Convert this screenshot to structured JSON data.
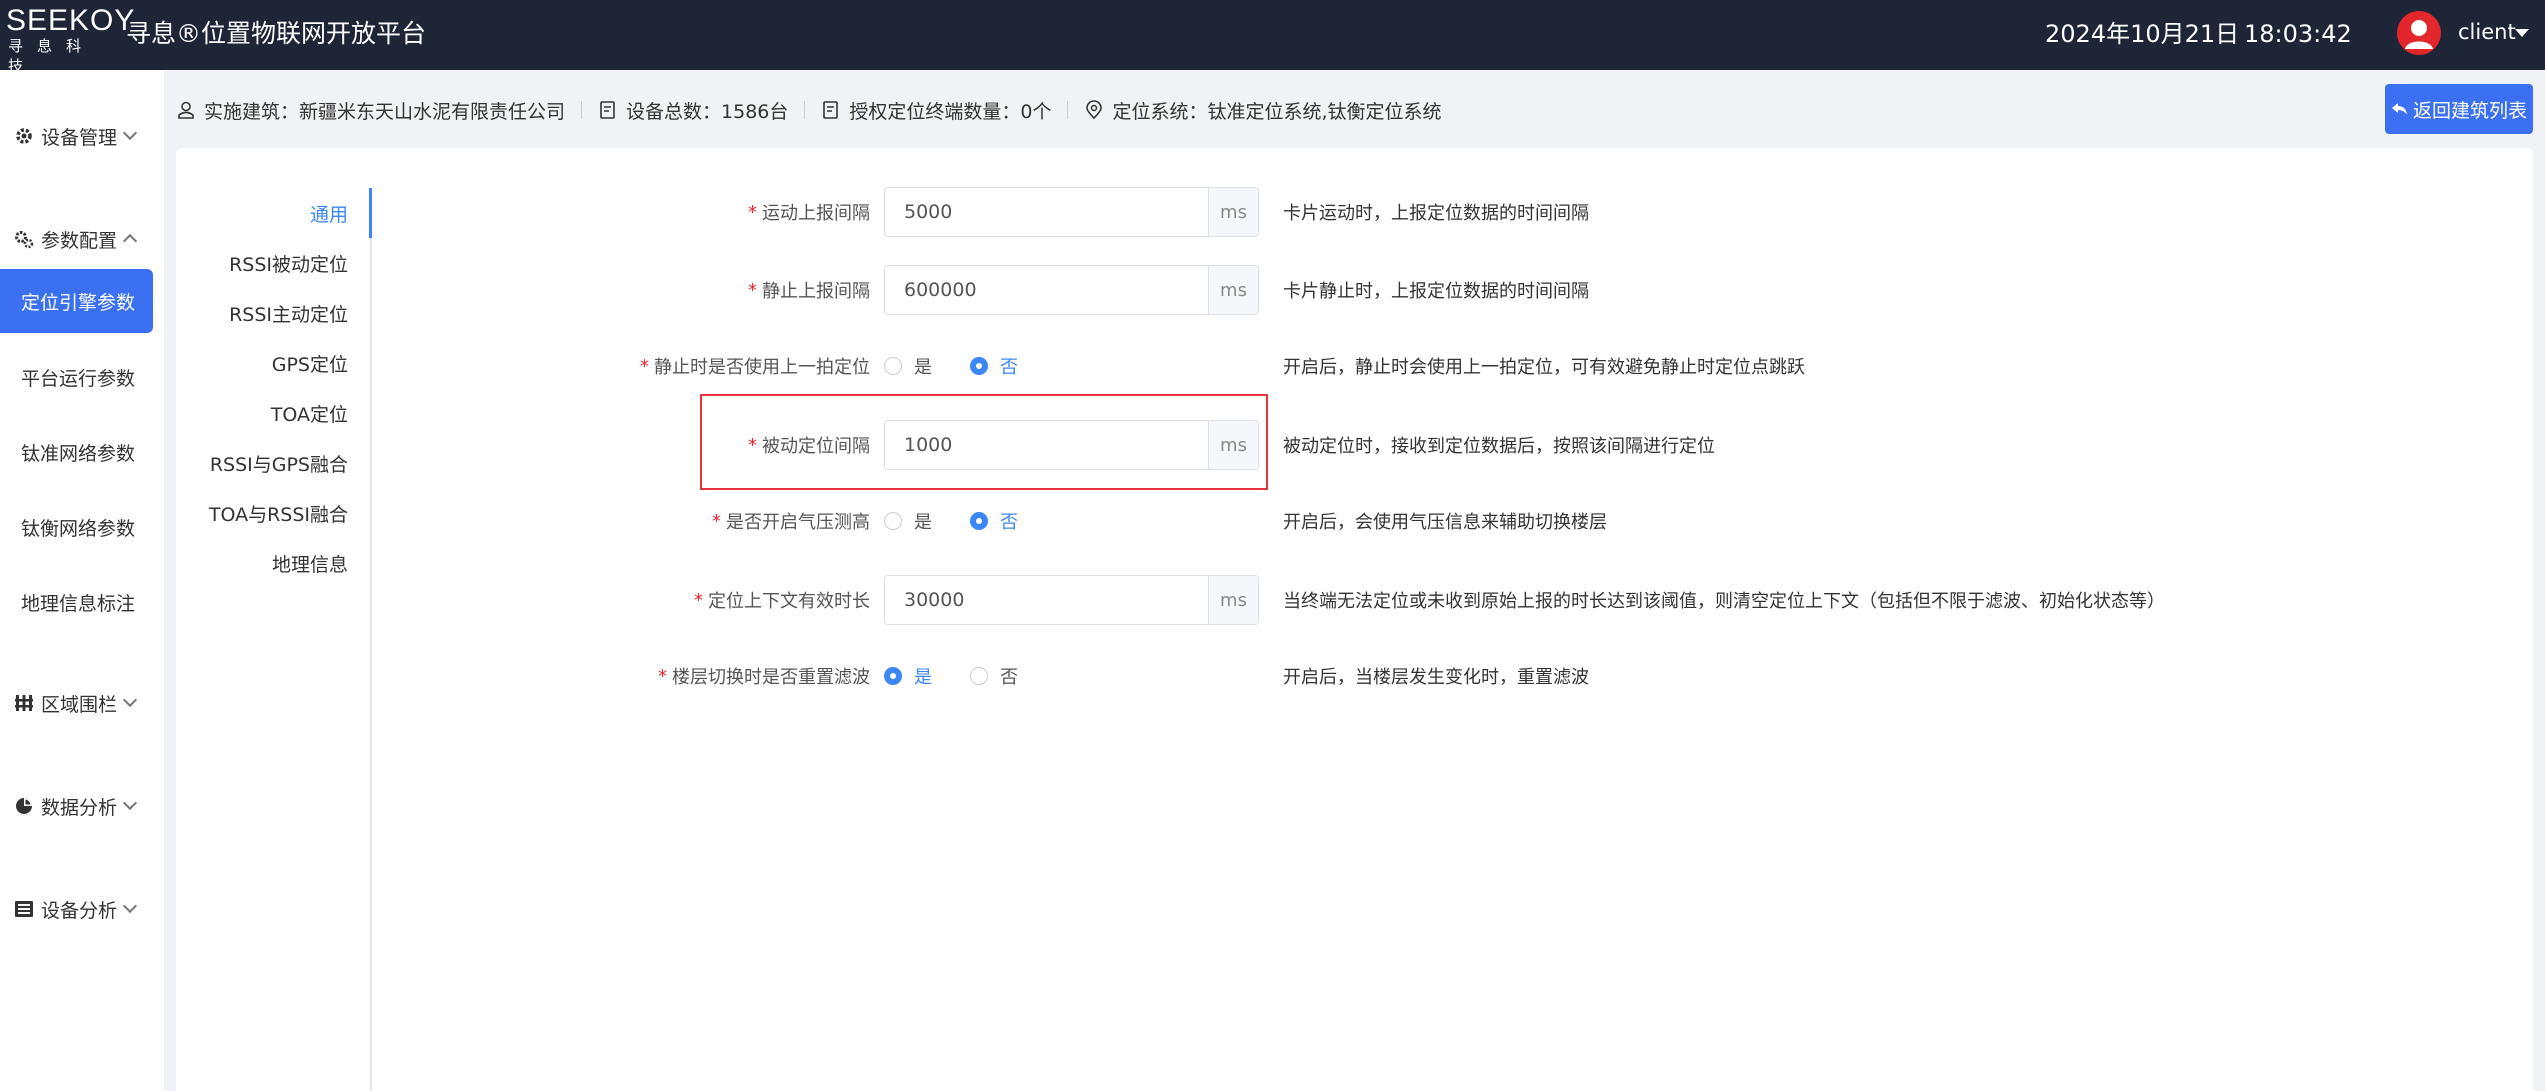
{
  "header": {
    "logo_brand": "SEEKOY",
    "logo_sub": "寻息科技",
    "title": "寻息®位置物联网开放平台",
    "date": "2024年10月21日",
    "time": "18:03:42",
    "username": "client"
  },
  "sidebar": {
    "groups": {
      "device_mgmt": "设备管理",
      "param_config": "参数配置",
      "area_fence": "区域围栏",
      "data_analysis": "数据分析",
      "device_analysis": "设备分析"
    },
    "items": {
      "engine_params": "定位引擎参数",
      "platform_params": "平台运行参数",
      "taizhun_params": "钛准网络参数",
      "taiheng_params": "钛衡网络参数",
      "geo_label": "地理信息标注"
    }
  },
  "infobar": {
    "building": "实施建筑：新疆米东天山水泥有限责任公司",
    "device_total": "设备总数：1586台",
    "licensed": "授权定位终端数量：0个",
    "system": "定位系统：钛准定位系统,钛衡定位系统",
    "back_button": "返回建筑列表"
  },
  "subnav": {
    "items": [
      "通用",
      "RSSI被动定位",
      "RSSI主动定位",
      "GPS定位",
      "TOA定位",
      "RSSI与GPS融合",
      "TOA与RSSI融合",
      "地理信息"
    ],
    "active": "通用"
  },
  "form": {
    "required_mark": "*",
    "unit": "ms",
    "yes": "是",
    "no": "否",
    "motion_interval": {
      "label": "运动上报间隔",
      "value": "5000",
      "desc": "卡片运动时，上报定位数据的时间间隔"
    },
    "static_interval": {
      "label": "静止上报间隔",
      "value": "600000",
      "desc": "卡片静止时，上报定位数据的时间间隔"
    },
    "static_use_last": {
      "label": "静止时是否使用上一拍定位",
      "selected": "否",
      "desc": "开启后，静止时会使用上一拍定位，可有效避免静止时定位点跳跃"
    },
    "passive_interval": {
      "label": "被动定位间隔",
      "value": "1000",
      "desc": "被动定位时，接收到定位数据后，按照该间隔进行定位"
    },
    "barometer": {
      "label": "是否开启气压测高",
      "selected": "否",
      "desc": "开启后，会使用气压信息来辅助切换楼层"
    },
    "context_valid": {
      "label": "定位上下文有效时长",
      "value": "30000",
      "desc": "当终端无法定位或未收到原始上报的时长达到该阈值，则清空定位上下文（包括但不限于滤波、初始化状态等）"
    },
    "floor_reset": {
      "label": "楼层切换时是否重置滤波",
      "selected": "是",
      "desc": "开启后，当楼层发生变化时，重置滤波"
    }
  },
  "colors": {
    "topbar": "#1e2537",
    "accent": "#3b70f2",
    "active_text": "#3b87f5",
    "highlight": "#e8323c",
    "required": "#f5222d"
  }
}
